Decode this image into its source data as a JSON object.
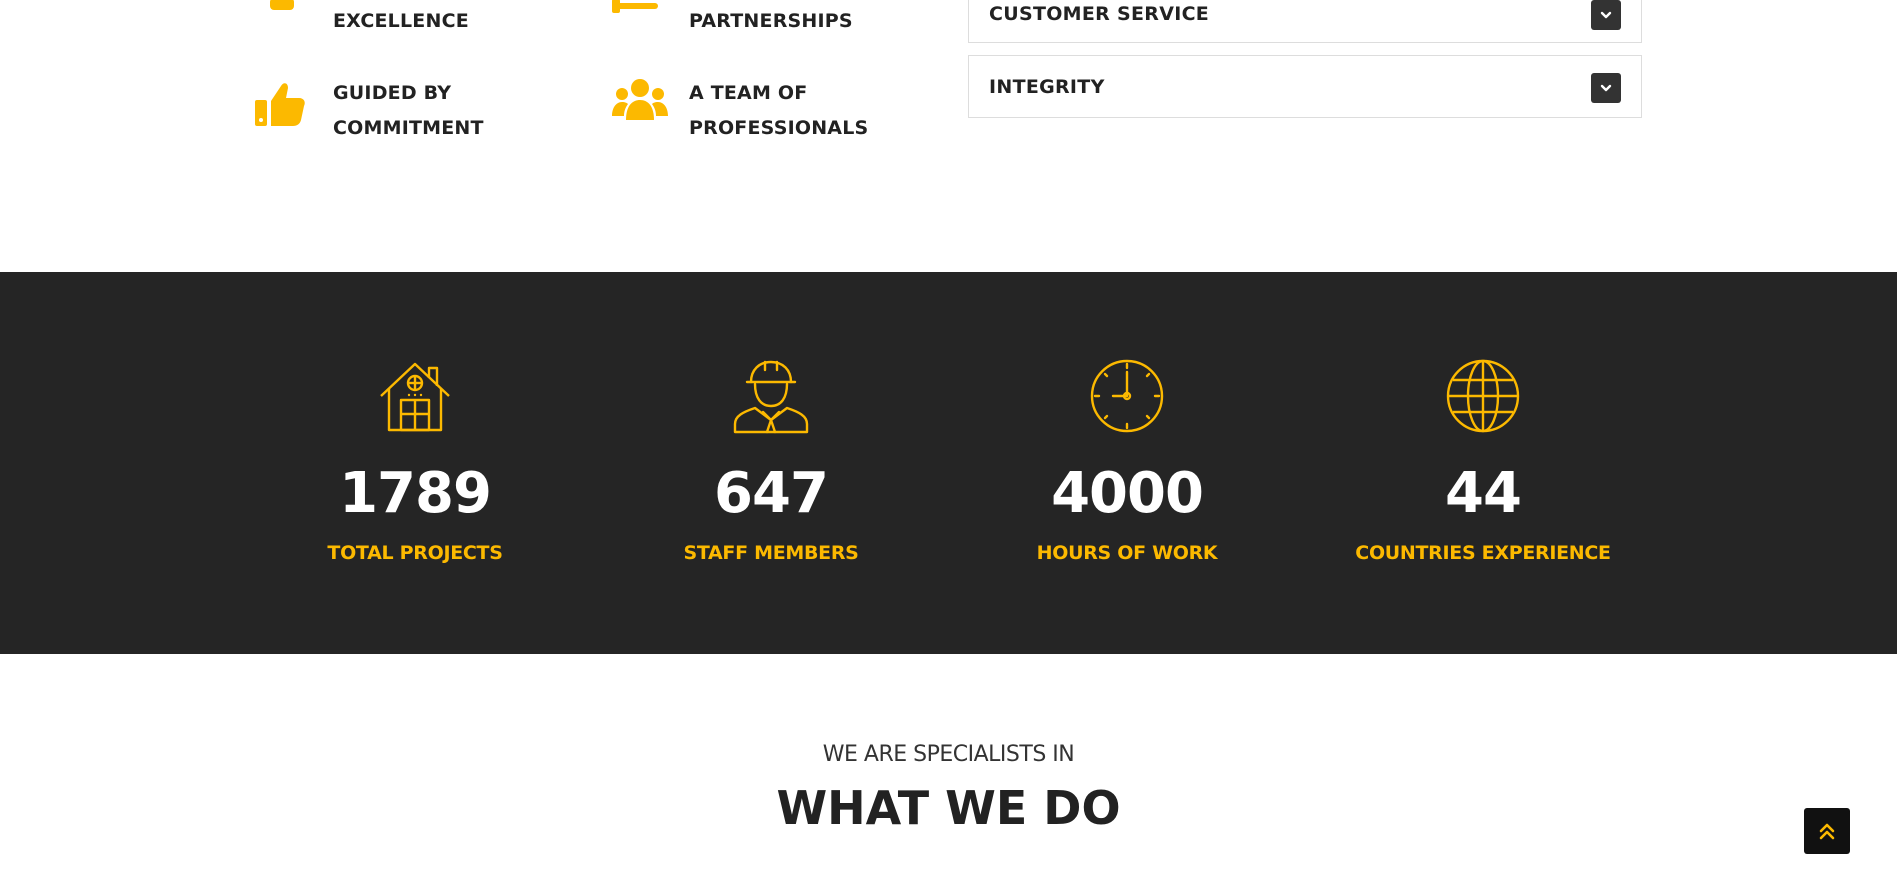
{
  "features": [
    {
      "icon": "award-icon",
      "label_lines": [
        "",
        "EXCELLENCE"
      ]
    },
    {
      "icon": "handshake-icon",
      "label_lines": [
        "",
        "PARTNERSHIPS"
      ]
    },
    {
      "icon": "thumbs-up-icon",
      "label_lines": [
        "GUIDED BY",
        "COMMITMENT"
      ]
    },
    {
      "icon": "team-icon",
      "label_lines": [
        "A TEAM OF",
        "PROFESSIONALS"
      ]
    }
  ],
  "accordion": [
    {
      "title": "CUSTOMER SERVICE",
      "icon": "chevron-down-icon"
    },
    {
      "title": "INTEGRITY",
      "icon": "chevron-down-icon"
    }
  ],
  "counters": [
    {
      "icon": "house-icon",
      "value": "1789",
      "label": "TOTAL PROJECTS"
    },
    {
      "icon": "worker-icon",
      "value": "647",
      "label": "STAFF MEMBERS"
    },
    {
      "icon": "clock-icon",
      "value": "4000",
      "label": "HOURS OF WORK"
    },
    {
      "icon": "globe-icon",
      "value": "44",
      "label": "COUNTRIES EXPERIENCE"
    }
  ],
  "specialists": {
    "subtitle": "WE ARE SPECIALISTS IN",
    "title": "WHAT WE DO"
  },
  "scroll_top": {
    "icon": "double-chevron-up-icon"
  },
  "colors": {
    "accent": "#fcb900",
    "dark_band": "#252525",
    "text": "#222222",
    "accordion_button": "#333333"
  }
}
